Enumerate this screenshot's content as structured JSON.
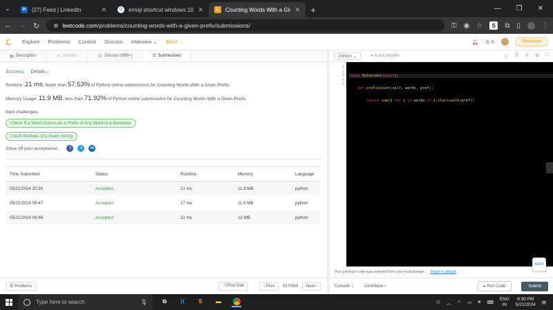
{
  "browser": {
    "tabs": [
      {
        "title": "(27) Feed | LinkedIn",
        "favicon": "in",
        "favicon_color": "#0a66c2"
      },
      {
        "title": "emoji shortcut windows 10 - Go",
        "favicon": "G",
        "favicon_color": "#ffffff"
      },
      {
        "title": "Counting Words With a Given P",
        "favicon": "L",
        "favicon_color": "#f89f1b"
      }
    ],
    "url_host": "leetcode.com",
    "url_path": "/problems/counting-words-with-a-given-prefix/submissions/"
  },
  "nav": {
    "items": [
      "Explore",
      "Problems",
      "Contest",
      "Discuss",
      "Interview",
      "Store"
    ],
    "notif_count": "0",
    "premium": "Premium"
  },
  "subtabs": [
    "Description",
    "Solution",
    "Discuss (999+)",
    "Submissions"
  ],
  "result": {
    "status": "Success",
    "details": "Details",
    "runtime_prefix": "Runtime: ",
    "runtime_value": "21 ms",
    "runtime_mid": ", faster than ",
    "runtime_pct": "57.53%",
    "runtime_suffix": " of Python online submissions for Counting Words With a Given Prefix.",
    "memory_prefix": "Memory Usage: ",
    "memory_value": "11.9 MB",
    "memory_mid": ", less than ",
    "memory_pct": "71.92%",
    "memory_suffix": " of Python online submissions for Counting Words With a Given Prefix.",
    "next_label": "Next challenges:",
    "challenges": [
      "Check If a Word Occurs As a Prefix of Any Word in a Sentence",
      "Count Prefixes of a Given String"
    ],
    "share_label": "Show off your acceptance:"
  },
  "table": {
    "headers": [
      "Time Submitted",
      "Status",
      "Runtime",
      "Memory",
      "Language"
    ],
    "rows": [
      [
        "05/21/2024 20:30",
        "Accepted",
        "21 ms",
        "11.9 MB",
        "python"
      ],
      [
        "05/21/2024 09:47",
        "Accepted",
        "17 ms",
        "11.9 MB",
        "python"
      ],
      [
        "05/21/2024 09:46",
        "Accepted",
        "21 ms",
        "12 MB",
        "python"
      ]
    ]
  },
  "bottom_left": {
    "problems": "Problems",
    "pick_one": "Pick One",
    "prev": "Prev",
    "page": "617/699",
    "next": "Next"
  },
  "editor": {
    "language": "Python",
    "autocomplete": "Autocomplete",
    "line_numbers": [
      "1",
      "2",
      "3",
      "4",
      "5"
    ],
    "code_lines": [
      "class Solution(object):",
      "    def prefixCount(self, words, pref):",
      "        return sum(1 for i in words if i.startswith(pref))",
      "",
      ""
    ],
    "new_badge": "NEW",
    "restore_msg": "Your previous code was restored from your local storage.",
    "reset_link": "Reset to default",
    "console": "Console",
    "contribute": "Contribute",
    "run_code": "Run Code",
    "submit": "Submit"
  },
  "taskbar": {
    "search_placeholder": "Type here to search",
    "lang_top": "ENG",
    "lang_bottom": "IN",
    "time": "8:30 PM",
    "date": "5/21/2024"
  }
}
